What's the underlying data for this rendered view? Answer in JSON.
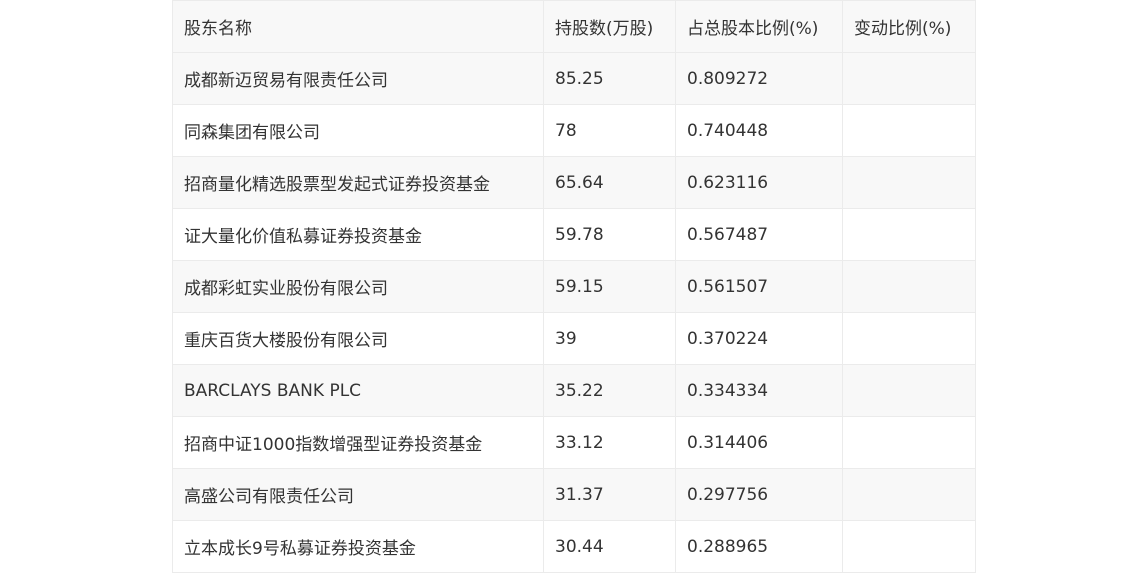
{
  "table": {
    "headers": [
      "股东名称",
      "持股数(万股)",
      "占总股本比例(%)",
      "变动比例(%)"
    ],
    "rows": [
      [
        "成都新迈贸易有限责任公司",
        "85.25",
        "0.809272",
        ""
      ],
      [
        "同森集团有限公司",
        "78",
        "0.740448",
        ""
      ],
      [
        "招商量化精选股票型发起式证券投资基金",
        "65.64",
        "0.623116",
        ""
      ],
      [
        "证大量化价值私募证券投资基金",
        "59.78",
        "0.567487",
        ""
      ],
      [
        "成都彩虹实业股份有限公司",
        "59.15",
        "0.561507",
        ""
      ],
      [
        "重庆百货大楼股份有限公司",
        "39",
        "0.370224",
        ""
      ],
      [
        "BARCLAYS BANK PLC",
        "35.22",
        "0.334334",
        ""
      ],
      [
        "招商中证1000指数增强型证券投资基金",
        "33.12",
        "0.314406",
        ""
      ],
      [
        "高盛公司有限责任公司",
        "31.37",
        "0.297756",
        ""
      ],
      [
        "立本成长9号私募证券投资基金",
        "30.44",
        "0.288965",
        ""
      ]
    ]
  }
}
